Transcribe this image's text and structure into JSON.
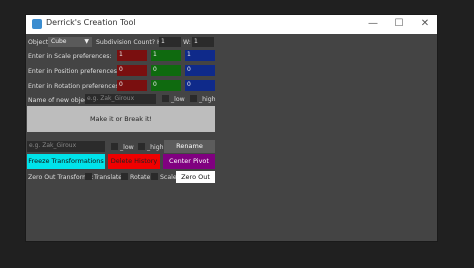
{
  "window": {
    "title": "Derrick's Creation Tool"
  },
  "titlebar_buttons": [
    "—",
    "☐",
    "✕"
  ],
  "object": {
    "label": "Object",
    "value": "Cube"
  },
  "subdivision": {
    "label": "Subdivision Count? H:",
    "h": "1",
    "w_label": "W:",
    "w": "1"
  },
  "scale": {
    "label": "Enter in Scale preferences:",
    "values": [
      "1",
      "1",
      "1"
    ]
  },
  "position": {
    "label": "Enter in Position preferences:",
    "values": [
      "0",
      "0",
      "0"
    ]
  },
  "rotation": {
    "label": "Enter in Rotation preferences:",
    "values": [
      "0",
      "0",
      "0"
    ]
  },
  "colors": {
    "red": "#7a0f0f",
    "green": "#0f6a0f",
    "blue": "#0f2a8a"
  },
  "name": {
    "label": "Name of new object:",
    "placeholder": "e.g. Zak_Giroux",
    "low": "_low",
    "high": "_high"
  },
  "make_button": "Make it or Break it!",
  "rename": {
    "placeholder": "e.g. Zak_Giroux",
    "low": "_low",
    "high": "_high",
    "button": "Rename"
  },
  "actions": {
    "freeze": "Freeze Transformations",
    "delete": "Delete History",
    "center": "Center Pivot"
  },
  "zero": {
    "label": "Zero Out Transforms:",
    "translate": "Translate",
    "rotate": "Rotate",
    "scale": "Scale",
    "button": "Zero Out"
  }
}
